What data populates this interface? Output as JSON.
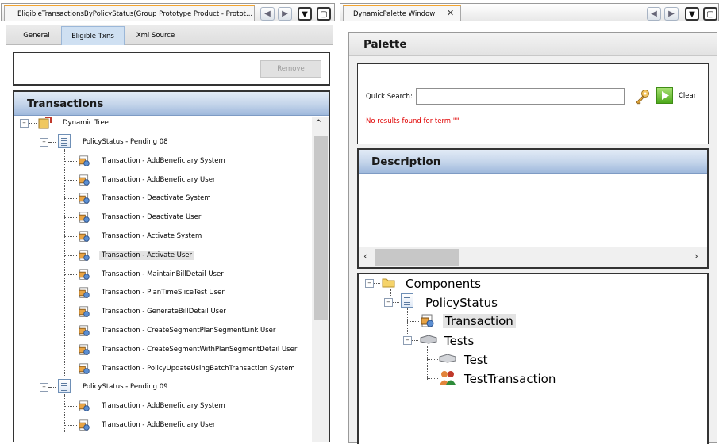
{
  "left_window": {
    "title": "EligibleTransactionsByPolicyStatus(Group Prototype Product - Protot...",
    "tabs": [
      "General",
      "Eligible Txns",
      "Xml Source"
    ],
    "remove_label": "Remove",
    "panel_title": "Transactions",
    "tree": {
      "root": "Dynamic Tree",
      "groups": [
        {
          "label": "PolicyStatus - Pending 08",
          "items": [
            "Transaction - AddBeneficiary System",
            "Transaction - AddBeneficiary User",
            "Transaction - Deactivate System",
            "Transaction - Deactivate User",
            "Transaction - Activate System",
            "Transaction - Activate User",
            "Transaction - MaintainBillDetail User",
            "Transaction - PlanTimeSliceTest User",
            "Transaction - GenerateBillDetail User",
            "Transaction - CreateSegmentPlanSegmentLink User",
            "Transaction - CreateSegmentWithPlanSegmentDetail User",
            "Transaction - PolicyUpdateUsingBatchTransaction System"
          ]
        },
        {
          "label": "PolicyStatus - Pending 09",
          "items": [
            "Transaction - AddBeneficiary System",
            "Transaction - AddBeneficiary User"
          ]
        }
      ]
    }
  },
  "right_window": {
    "title": "DynamicPalette Window",
    "palette_title": "Palette",
    "quick_search_label": "Quick Search:",
    "quick_search_value": "",
    "clear_label": "Clear",
    "no_results": "No results found for term \"\"",
    "description_title": "Description",
    "components_tree": {
      "root": "Components",
      "policy_status": "PolicyStatus",
      "transaction": "Transaction",
      "tests": "Tests",
      "test": "Test",
      "test_transaction": "TestTransaction"
    }
  }
}
